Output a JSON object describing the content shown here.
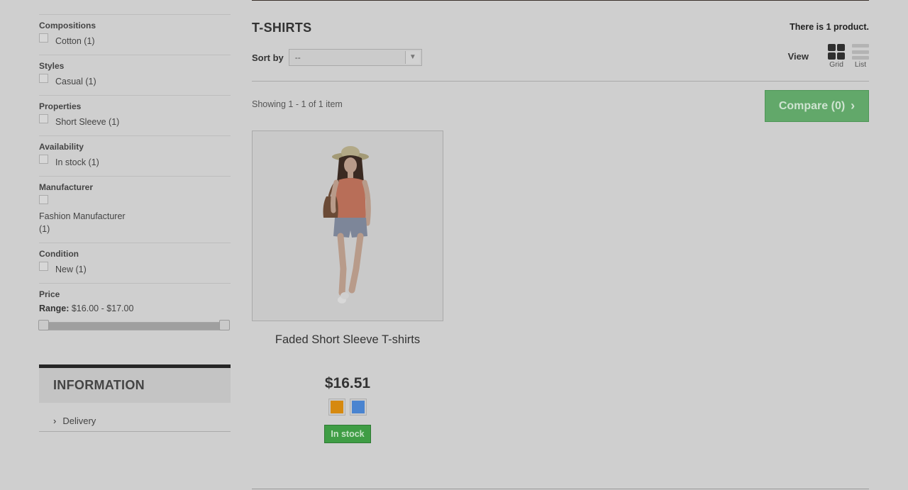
{
  "filters": {
    "compositions": {
      "title": "Compositions",
      "options": [
        "Cotton (1)"
      ]
    },
    "styles": {
      "title": "Styles",
      "options": [
        "Casual (1)"
      ]
    },
    "properties": {
      "title": "Properties",
      "options": [
        "Short Sleeve (1)"
      ]
    },
    "availability": {
      "title": "Availability",
      "options": [
        "In stock (1)"
      ]
    },
    "manufacturer": {
      "title": "Manufacturer",
      "options": [
        "Fashion Manufacturer (1)"
      ]
    },
    "condition": {
      "title": "Condition",
      "options": [
        "New (1)"
      ]
    },
    "price": {
      "title": "Price",
      "range_label": "Range:",
      "range_value": "$16.00 - $17.00",
      "slider_fill_fraction": 1.0
    }
  },
  "information": {
    "title": "INFORMATION",
    "links": [
      "Delivery"
    ]
  },
  "category": {
    "title": "T-SHIRTS",
    "count_text": "There is 1 product."
  },
  "sort": {
    "label": "Sort by",
    "selected": "--"
  },
  "view": {
    "label": "View",
    "grid_label": "Grid",
    "list_label": "List",
    "active": "grid"
  },
  "showing": "Showing 1 - 1 of 1 item",
  "compare": {
    "label": "Compare (0)"
  },
  "product": {
    "name": "Faded Short Sleeve T-shirts",
    "price": "$16.51",
    "colors": [
      "#d6890f",
      "#4a84d0"
    ],
    "stock": "In stock"
  }
}
